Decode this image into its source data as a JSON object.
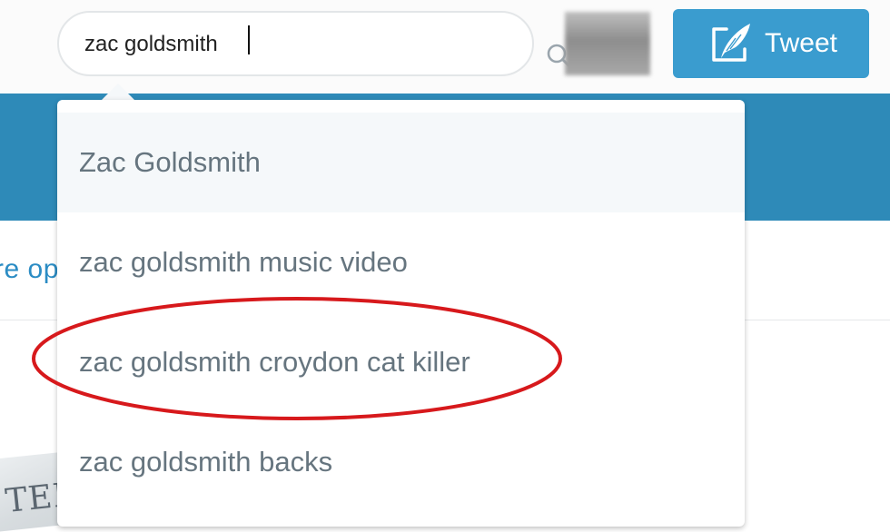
{
  "search": {
    "value": "zac goldsmith",
    "icon": "search-icon"
  },
  "header": {
    "tweet_button_label": "Tweet",
    "tweet_icon": "quill-icon"
  },
  "background": {
    "partial_link_text": "re op",
    "photo_text": "TER"
  },
  "suggestions": [
    {
      "label": "Zac Goldsmith"
    },
    {
      "label": "zac goldsmith music video"
    },
    {
      "label": "zac goldsmith croydon cat killer"
    },
    {
      "label": "zac goldsmith backs"
    }
  ],
  "colors": {
    "brand_blue": "#2e8ab8",
    "tweet_button": "#3a9ccf",
    "highlight_circle": "#d7191c",
    "suggestion_text": "#66757f"
  }
}
